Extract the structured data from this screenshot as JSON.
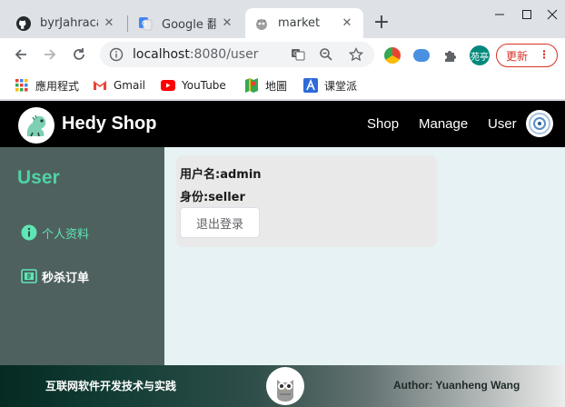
{
  "browser": {
    "tabs": [
      {
        "title": "byrJahracal",
        "icon": "github-icon"
      },
      {
        "title": "Google 翻译",
        "icon": "google-translate-icon"
      },
      {
        "title": "market",
        "icon": "shop-icon",
        "active": true
      }
    ],
    "url_host": "localhost",
    "url_path": ":8080/user",
    "profile_label": "苑亭",
    "update_label": "更新",
    "bookmarks": [
      {
        "label": "應用程式",
        "icon": "apps-grid-icon"
      },
      {
        "label": "Gmail",
        "icon": "gmail-icon"
      },
      {
        "label": "YouTube",
        "icon": "youtube-icon"
      },
      {
        "label": "地圖",
        "icon": "maps-icon"
      },
      {
        "label": "课堂派",
        "icon": "ketangpai-icon"
      }
    ]
  },
  "navbar": {
    "brand": "Hedy Shop",
    "links": [
      "Shop",
      "Manage",
      "User"
    ]
  },
  "sidebar": {
    "title": "User",
    "items": [
      {
        "label": "个人资料",
        "icon": "info-icon",
        "active": true
      },
      {
        "label": "秒杀订单",
        "icon": "order-icon",
        "active": false
      }
    ]
  },
  "profile": {
    "username_line": "用户名:admin",
    "role_line": "身份:seller",
    "logout_label": "退出登录"
  },
  "footer": {
    "left_text": "互联网软件开发技术与实践",
    "right_text": "Author: Yuanheng Wang"
  },
  "colors": {
    "nav_bg": "#000000",
    "sidebar_bg": "#4e615f",
    "accent_green": "#4fd3a4",
    "content_bg": "#e6f2f3",
    "update_red": "#d93025"
  }
}
